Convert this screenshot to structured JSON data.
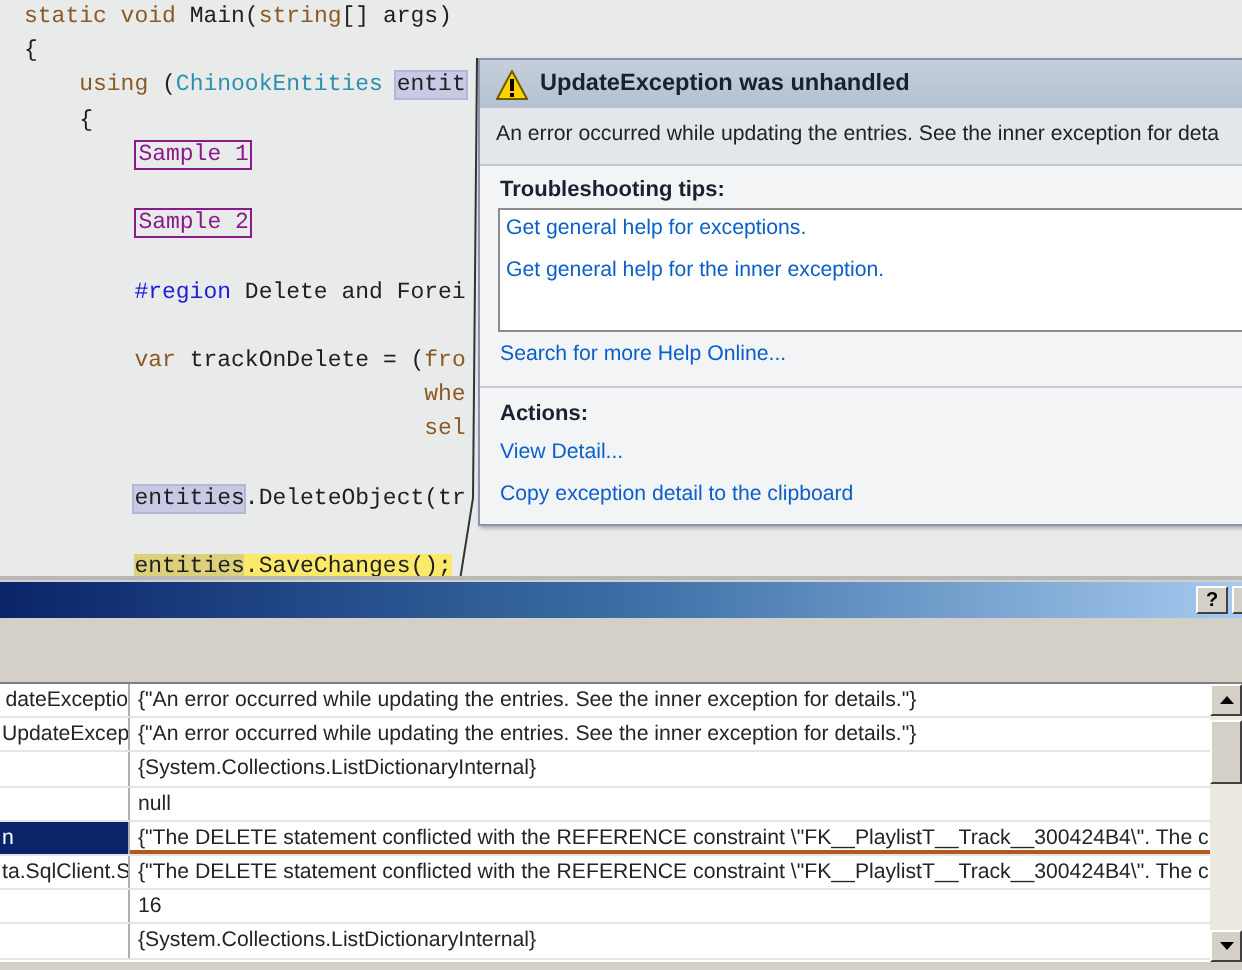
{
  "code_lines": [
    {
      "kind": "top",
      "segments": [
        {
          "text": "static void",
          "kind": "keyword"
        },
        {
          "text": " Main(",
          "kind": "plain"
        },
        {
          "text": "string",
          "kind": "keyword"
        },
        {
          "text": "[] args)",
          "kind": "plain"
        }
      ]
    },
    {
      "kind": "top",
      "segments": [
        {
          "text": "{",
          "kind": "plain"
        }
      ]
    },
    {
      "kind": "block",
      "segments": [
        {
          "text": "using",
          "kind": "keyword"
        },
        {
          "text": " (",
          "kind": "plain"
        },
        {
          "text": "ChinookEntities ",
          "kind": "type"
        },
        {
          "text": "entit",
          "kind": "reference"
        }
      ]
    },
    {
      "kind": "block",
      "segments": [
        {
          "text": "{",
          "kind": "plain"
        }
      ]
    },
    {
      "kind": "body",
      "segments": [
        {
          "text": "Sample 1",
          "kind": "collapsed"
        }
      ]
    },
    {
      "kind": "body"
    },
    {
      "kind": "body",
      "segments": [
        {
          "text": "Sample 2",
          "kind": "collapsed"
        }
      ]
    },
    {
      "kind": "body"
    },
    {
      "kind": "body",
      "segments": [
        {
          "text": "#region",
          "kind": "directive"
        },
        {
          "text": " Delete and Forei",
          "kind": "plain"
        }
      ]
    },
    {
      "kind": "body"
    },
    {
      "kind": "body",
      "segments": [
        {
          "text": "var",
          "kind": "keyword"
        },
        {
          "text": " trackOnDelete = (",
          "kind": "plain"
        },
        {
          "text": "fro",
          "kind": "keyword"
        }
      ]
    },
    {
      "kind": "continuation",
      "segments": [
        {
          "text": "whe",
          "kind": "keyword"
        }
      ]
    },
    {
      "kind": "continuation",
      "segments": [
        {
          "text": "sel",
          "kind": "keyword"
        }
      ]
    },
    {
      "kind": "body"
    },
    {
      "kind": "body",
      "segments": [
        {
          "text": "entities",
          "kind": "reference"
        },
        {
          "text": ".DeleteObject(tr",
          "kind": "plain"
        }
      ]
    },
    {
      "kind": "body"
    },
    {
      "kind": "body",
      "segments": [
        {
          "text": "entities",
          "kind": "current-reference"
        },
        {
          "text": ".SaveChanges();",
          "kind": "current"
        }
      ]
    }
  ],
  "exception_popup": {
    "title": "UpdateException was unhandled",
    "message": "An error occurred while updating the entries. See the inner exception for deta",
    "tips_heading": "Troubleshooting tips:",
    "tips": [
      "Get general help for exceptions.",
      "Get general help for the inner exception."
    ],
    "help_link": "Search for more Help Online...",
    "actions_heading": "Actions:",
    "actions": [
      "View Detail...",
      "Copy exception detail to the clipboard"
    ]
  },
  "details_window": {
    "help_button": "?"
  },
  "grid_rows": [
    {
      "name": "dateExceptio",
      "value": "{\"An error occurred while updating the entries. See the inner exception for details.\"}",
      "selected": false
    },
    {
      "name": "UpdateExcep",
      "value": "{\"An error occurred while updating the entries. See the inner exception for details.\"}",
      "selected": false
    },
    {
      "value": "{System.Collections.ListDictionaryInternal}",
      "selected": false
    },
    {
      "value": "null",
      "selected": false
    },
    {
      "name": "n",
      "value": "{\"The DELETE statement conflicted with the REFERENCE constraint \\\"FK__PlaylistT__Track__300424B4\\\". The c",
      "selected": true
    },
    {
      "name": "ta.SqlClient.S",
      "value": "{\"The DELETE statement conflicted with the REFERENCE constraint \\\"FK__PlaylistT__Track__300424B4\\\". The c",
      "selected": false
    },
    {
      "value": "16",
      "selected": false
    },
    {
      "value": "{System.Collections.ListDictionaryInternal}",
      "selected": false
    }
  ]
}
